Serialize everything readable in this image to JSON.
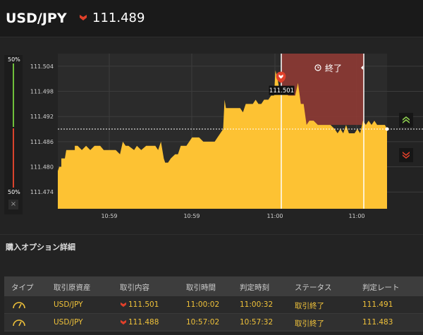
{
  "header": {
    "pair": "USD/JPY",
    "price": "111.489",
    "direction_icon": "down-arrow-icon"
  },
  "chart_data": {
    "type": "area",
    "y_ticks": [
      "111.504",
      "111.498",
      "111.492",
      "111.486",
      "111.480",
      "111.474"
    ],
    "ylim": [
      111.47,
      111.507
    ],
    "x_ticks": [
      "10:59",
      "10:59",
      "11:00",
      "11:00"
    ],
    "series_points": [
      [
        0,
        111.479
      ],
      [
        2,
        111.48
      ],
      [
        5,
        111.48
      ],
      [
        5,
        111.482
      ],
      [
        10,
        111.482
      ],
      [
        12,
        111.484
      ],
      [
        16,
        111.484
      ],
      [
        24,
        111.484
      ],
      [
        24,
        111.485
      ],
      [
        28,
        111.485
      ],
      [
        34,
        111.484
      ],
      [
        40,
        111.485
      ],
      [
        46,
        111.484
      ],
      [
        52,
        111.485
      ],
      [
        60,
        111.485
      ],
      [
        65,
        111.484
      ],
      [
        72,
        111.484
      ],
      [
        78,
        111.484
      ],
      [
        82,
        111.484
      ],
      [
        88,
        111.483
      ],
      [
        92,
        111.486
      ],
      [
        96,
        111.485
      ],
      [
        100,
        111.485
      ],
      [
        108,
        111.484
      ],
      [
        112,
        111.485
      ],
      [
        118,
        111.484
      ],
      [
        125,
        111.485
      ],
      [
        132,
        111.485
      ],
      [
        138,
        111.485
      ],
      [
        142,
        111.484
      ],
      [
        146,
        111.486
      ],
      [
        150,
        111.482
      ],
      [
        152,
        111.481
      ],
      [
        156,
        111.481
      ],
      [
        160,
        111.482
      ],
      [
        166,
        111.483
      ],
      [
        170,
        111.483
      ],
      [
        174,
        111.485
      ],
      [
        178,
        111.485
      ],
      [
        182,
        111.485
      ],
      [
        186,
        111.486
      ],
      [
        190,
        111.487
      ],
      [
        196,
        111.487
      ],
      [
        200,
        111.487
      ],
      [
        206,
        111.486
      ],
      [
        214,
        111.486
      ],
      [
        222,
        111.486
      ],
      [
        226,
        111.487
      ],
      [
        230,
        111.488
      ],
      [
        234,
        111.489
      ],
      [
        236,
        111.496
      ],
      [
        238,
        111.494
      ],
      [
        242,
        111.494
      ],
      [
        246,
        111.494
      ],
      [
        252,
        111.494
      ],
      [
        258,
        111.494
      ],
      [
        262,
        111.493
      ],
      [
        266,
        111.495
      ],
      [
        272,
        111.495
      ],
      [
        276,
        111.495
      ],
      [
        280,
        111.496
      ],
      [
        284,
        111.495
      ],
      [
        288,
        111.495
      ],
      [
        292,
        111.496
      ],
      [
        298,
        111.496
      ],
      [
        302,
        111.497
      ],
      [
        306,
        111.497
      ],
      [
        308,
        111.503
      ],
      [
        311,
        111.501
      ],
      [
        314,
        111.498
      ],
      [
        318,
        111.499
      ],
      [
        322,
        111.499
      ],
      [
        326,
        111.497
      ],
      [
        330,
        111.497
      ],
      [
        336,
        111.497
      ],
      [
        340,
        111.5
      ],
      [
        344,
        111.495
      ],
      [
        348,
        111.495
      ],
      [
        352,
        111.49
      ],
      [
        356,
        111.491
      ],
      [
        362,
        111.491
      ],
      [
        368,
        111.49
      ],
      [
        374,
        111.49
      ],
      [
        380,
        111.49
      ],
      [
        386,
        111.49
      ],
      [
        392,
        111.489
      ],
      [
        396,
        111.488
      ],
      [
        400,
        111.489
      ],
      [
        404,
        111.488
      ],
      [
        408,
        111.49
      ],
      [
        412,
        111.488
      ],
      [
        416,
        111.488
      ],
      [
        420,
        111.488
      ],
      [
        424,
        111.489
      ],
      [
        428,
        111.488
      ],
      [
        432,
        111.491
      ],
      [
        436,
        111.49
      ],
      [
        440,
        111.491
      ],
      [
        444,
        111.49
      ],
      [
        448,
        111.491
      ],
      [
        452,
        111.49
      ],
      [
        456,
        111.49
      ],
      [
        460,
        111.49
      ],
      [
        463,
        111.49
      ],
      [
        466,
        111.489
      ]
    ],
    "current_rate": 111.489,
    "entry_rate": "111.501",
    "entry_direction_icon": "down-arrow-icon",
    "expiry_label": "終了",
    "grid": true
  },
  "gauge": {
    "top_label": "50%",
    "bottom_label": "50%",
    "close_label": "×",
    "high_color": "#6fbf3a",
    "low_color": "#d9432c"
  },
  "side_buttons": {
    "up_icon": "up-chevron-icon",
    "down_icon": "down-chevron-icon"
  },
  "section": {
    "title": "購入オプション詳細"
  },
  "table": {
    "headers": [
      "タイプ",
      "取引原資産",
      "取引内容",
      "取引時間",
      "判定時刻",
      "ステータス",
      "判定レート"
    ],
    "rows": [
      {
        "type_icon": "gauge-icon",
        "asset": "USD/JPY",
        "direction_icon": "down-arrow-icon",
        "content": "111.501",
        "trade_time": "11:00:02",
        "judge_time": "11:00:32",
        "status": "取引終了",
        "rate": "111.491"
      },
      {
        "type_icon": "gauge-icon",
        "asset": "USD/JPY",
        "direction_icon": "down-arrow-icon",
        "content": "111.488",
        "trade_time": "10:57:02",
        "judge_time": "10:57:32",
        "status": "取引終了",
        "rate": "111.483"
      }
    ]
  },
  "colors": {
    "area_fill": "#fdc233",
    "accent": "#f0c23a",
    "down": "#e0402a",
    "up": "#8fd14f",
    "expiry_zone": "#8e3a34"
  }
}
